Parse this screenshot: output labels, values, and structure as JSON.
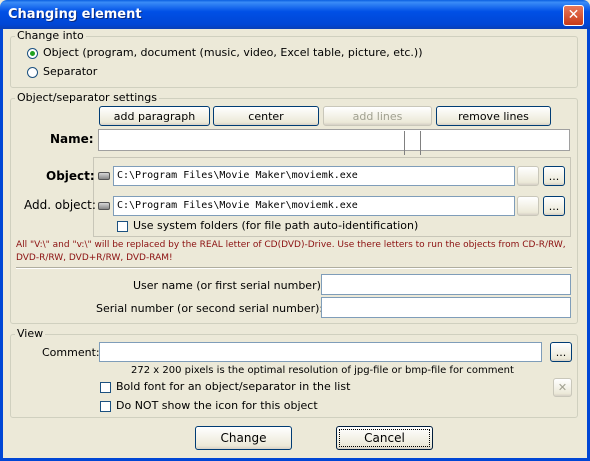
{
  "window": {
    "title": "Changing element",
    "close_glyph": "✕"
  },
  "change_into": {
    "legend": "Change into",
    "options": [
      {
        "label": "Object (program, document (music, video, Excel table, picture, etc.))",
        "selected": true
      },
      {
        "label": "Separator",
        "selected": false
      }
    ]
  },
  "settings": {
    "legend": "Object/separator settings",
    "toolbar": {
      "add_paragraph": "add paragraph",
      "center": "center",
      "add_lines": "add lines",
      "remove_lines": "remove lines"
    },
    "name_label": "Name:",
    "name_value": "",
    "object_label": "Object:",
    "object_path": "C:\\Program Files\\Movie Maker\\moviemk.exe",
    "add_object_label": "Add. object:",
    "add_object_path": "C:\\Program Files\\Movie Maker\\moviemk.exe",
    "browse_label": "...",
    "use_system_folders": "Use system folders (for file path auto-identification)",
    "note_line1": "All \"V:\\\" and \"v:\\\" will be replaced by the REAL letter of CD(DVD)-Drive. Use there letters to run the objects from CD-R/RW,",
    "note_line2": "DVD-R/RW, DVD+R/RW, DVD-RAM!",
    "user_name_label": "User name (or first serial number):",
    "user_name_value": "",
    "serial_label": "Serial number (or second serial number):",
    "serial_value": ""
  },
  "view": {
    "legend": "View",
    "comment_label": "Comment:",
    "comment_value": "",
    "comment_hint": "272 x 200 pixels is the optimal resolution of jpg-file or bmp-file for comment",
    "bold_font": "Bold font for an object/separator in the list",
    "hide_icon": "Do NOT show the icon for this object",
    "clear_glyph": "✕"
  },
  "footer": {
    "change": "Change",
    "cancel": "Cancel"
  },
  "colors": {
    "title_bar": "#0046d5",
    "dialog_bg": "#ece9d8",
    "note_text": "#8b1010"
  }
}
